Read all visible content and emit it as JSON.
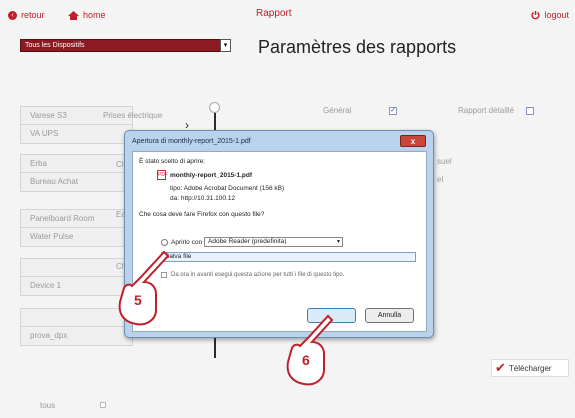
{
  "topnav": {
    "back_label": "retour",
    "home_label": "home",
    "title": "Rapport",
    "logout_label": "logout"
  },
  "device_select": {
    "value": "Tous les Dispositifs"
  },
  "heading": "Paramètres des rapports",
  "cards": [
    {
      "rows": [
        "Varese S3",
        "VA UPS"
      ]
    },
    {
      "rows": [
        "Erba",
        "Bureau Achat"
      ]
    },
    {
      "rows": [
        "Panelboard Room",
        "Water Pulse"
      ]
    },
    {
      "rows": [
        "",
        "Device 1"
      ]
    },
    {
      "rows": [
        "",
        "prova_dpx"
      ]
    }
  ],
  "mid_labels": [
    "Prises électrique",
    "Ch",
    "Ea",
    "Ch"
  ],
  "options": {
    "general_label": "Général",
    "detailed_label": "Rapport détaillé",
    "suel_fragment": "suel",
    "el_fragment": "el"
  },
  "tous_label": "tous",
  "download_label": "Télécharger",
  "dialog": {
    "title": "Apertura di monthly-report_2015-1.pdf",
    "intro": "È stato scelto di aprire:",
    "filename": "monthly-report_2015-1.pdf",
    "type_line": "tipo:  Adobe Acrobat Document (156 kB)",
    "from_line": "da:  http://10.31.100.12",
    "question": "Che cosa deve fare Firefox con questo file?",
    "open_with_label": "Aprirlo con",
    "open_with_app": "Adobe Reader  (predefinita)",
    "save_label": "Salva file",
    "remember_label": "Da ora in avanti esegui questa azione per tutti i file di questo tipo.",
    "ok_label": "",
    "cancel_label": "Annulla"
  },
  "callouts": [
    "5",
    "6"
  ],
  "colors": {
    "brand_red": "#c0202a",
    "dropdown_bg": "#8b1a22",
    "dialog_frame": "#b9d3ec"
  }
}
